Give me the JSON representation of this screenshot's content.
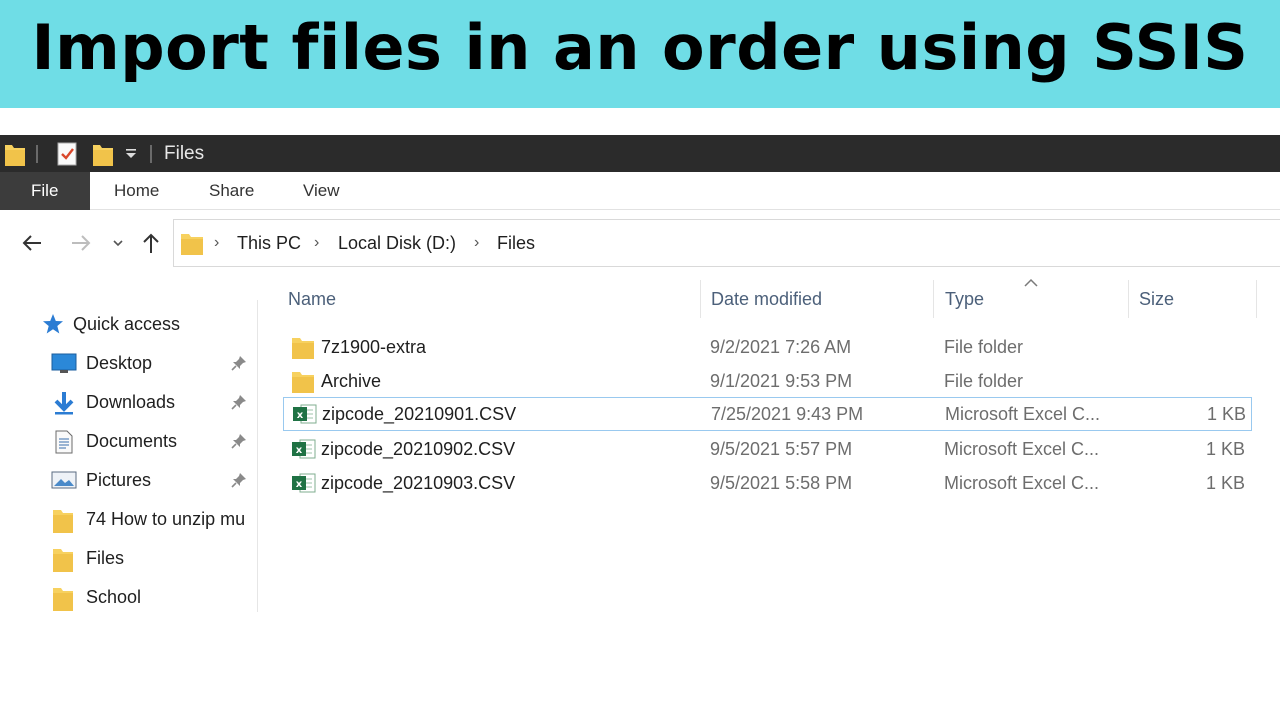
{
  "banner": {
    "title": "Import files in an order using SSIS"
  },
  "window": {
    "title": "Files",
    "ribbon_tabs": [
      "File",
      "Home",
      "Share",
      "View"
    ]
  },
  "address": {
    "breadcrumbs": [
      "This PC",
      "Local Disk (D:)",
      "Files"
    ]
  },
  "sidebar": {
    "items": [
      {
        "label": "Quick access",
        "icon": "star-icon"
      },
      {
        "label": "Desktop",
        "icon": "desktop-icon",
        "pinned": true
      },
      {
        "label": "Downloads",
        "icon": "download-arrow-icon",
        "pinned": true
      },
      {
        "label": "Documents",
        "icon": "document-icon",
        "pinned": true
      },
      {
        "label": "Pictures",
        "icon": "pictures-icon",
        "pinned": true
      },
      {
        "label": "74 How to unzip mu",
        "icon": "folder-icon"
      },
      {
        "label": "Files",
        "icon": "folder-icon"
      },
      {
        "label": "School",
        "icon": "folder-icon"
      }
    ]
  },
  "columns": [
    "Name",
    "Date modified",
    "Type",
    "Size"
  ],
  "files": [
    {
      "name": "7z1900-extra",
      "date": "9/2/2021 7:26 AM",
      "type": "File folder",
      "size": "",
      "icon": "folder-icon"
    },
    {
      "name": "Archive",
      "date": "9/1/2021 9:53 PM",
      "type": "File folder",
      "size": "",
      "icon": "folder-icon"
    },
    {
      "name": "zipcode_20210901.CSV",
      "date": "7/25/2021 9:43 PM",
      "type": "Microsoft Excel C...",
      "size": "1 KB",
      "icon": "excel-csv-icon",
      "selected": true
    },
    {
      "name": "zipcode_20210902.CSV",
      "date": "9/5/2021 5:57 PM",
      "type": "Microsoft Excel C...",
      "size": "1 KB",
      "icon": "excel-csv-icon"
    },
    {
      "name": "zipcode_20210903.CSV",
      "date": "9/5/2021 5:58 PM",
      "type": "Microsoft Excel C...",
      "size": "1 KB",
      "icon": "excel-csv-icon"
    }
  ],
  "colors": {
    "banner_bg": "#6fdde6",
    "titlebar_bg": "#2b2b2b",
    "folder_yellow": "#f7d15f",
    "excel_green": "#1f7244",
    "selection_border": "#99c9ef"
  }
}
